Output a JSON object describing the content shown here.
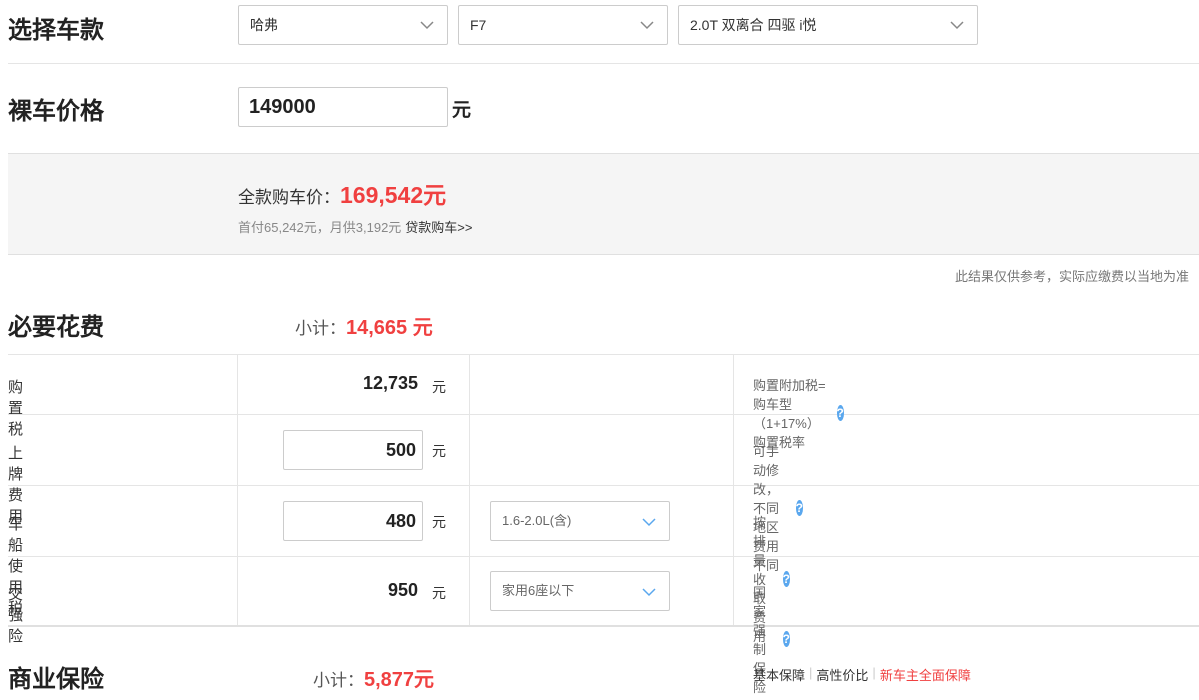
{
  "select_car": {
    "title": "选择车款",
    "brand": "哈弗",
    "model": "F7",
    "trim": "2.0T 双离合 四驱 i悦"
  },
  "bare_price": {
    "title": "裸车价格",
    "value": "149000",
    "unit": "元"
  },
  "summary": {
    "full_label": "全款购车价：",
    "full_value": "169,542元",
    "sub_text": "首付65,242元，月供3,192元",
    "loan_link": "贷款购车>>"
  },
  "disclaimer": "此结果仅供参考，实际应缴费以当地为准",
  "required": {
    "title": "必要花费",
    "subtotal_label": "小计：",
    "subtotal_value": "14,665 元",
    "rows": [
      {
        "label": "购置税",
        "value": "12,735",
        "unit": "元",
        "note": "购置附加税=购车型（1+17%）购置税率"
      },
      {
        "label": "上牌费用",
        "value": "500",
        "unit": "元",
        "note": "可手动修改，不同地区费用不同"
      },
      {
        "label": "车船使用税",
        "value": "480",
        "unit": "元",
        "option": "1.6-2.0L(含)",
        "note": "按排量收取费用"
      },
      {
        "label": "交强险",
        "value": "950",
        "unit": "元",
        "option": "家用6座以下",
        "note": "国家强制保险"
      }
    ]
  },
  "insurance": {
    "title": "商业保险",
    "subtotal_label": "小计：",
    "subtotal_value": "5,877元",
    "plans": [
      "基本保障",
      "高性价比",
      "新车主全面保障"
    ],
    "separator": "|"
  },
  "colors": {
    "accent": "#f04040",
    "help": "#5aa7ee"
  }
}
